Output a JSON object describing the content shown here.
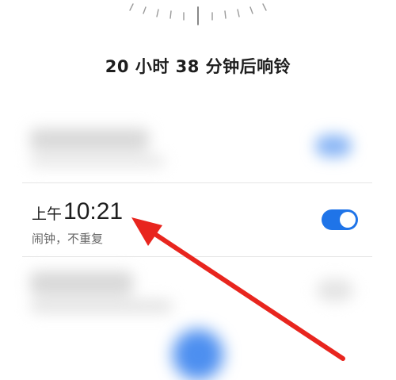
{
  "countdown_text": "20 小时 38 分钟后响铃",
  "alarm": {
    "ampm": "上午",
    "time": "10:21",
    "subtitle": "闹钟，不重复",
    "enabled": true
  },
  "colors": {
    "accent": "#1f74e8",
    "annotation_arrow": "#e8251e"
  }
}
